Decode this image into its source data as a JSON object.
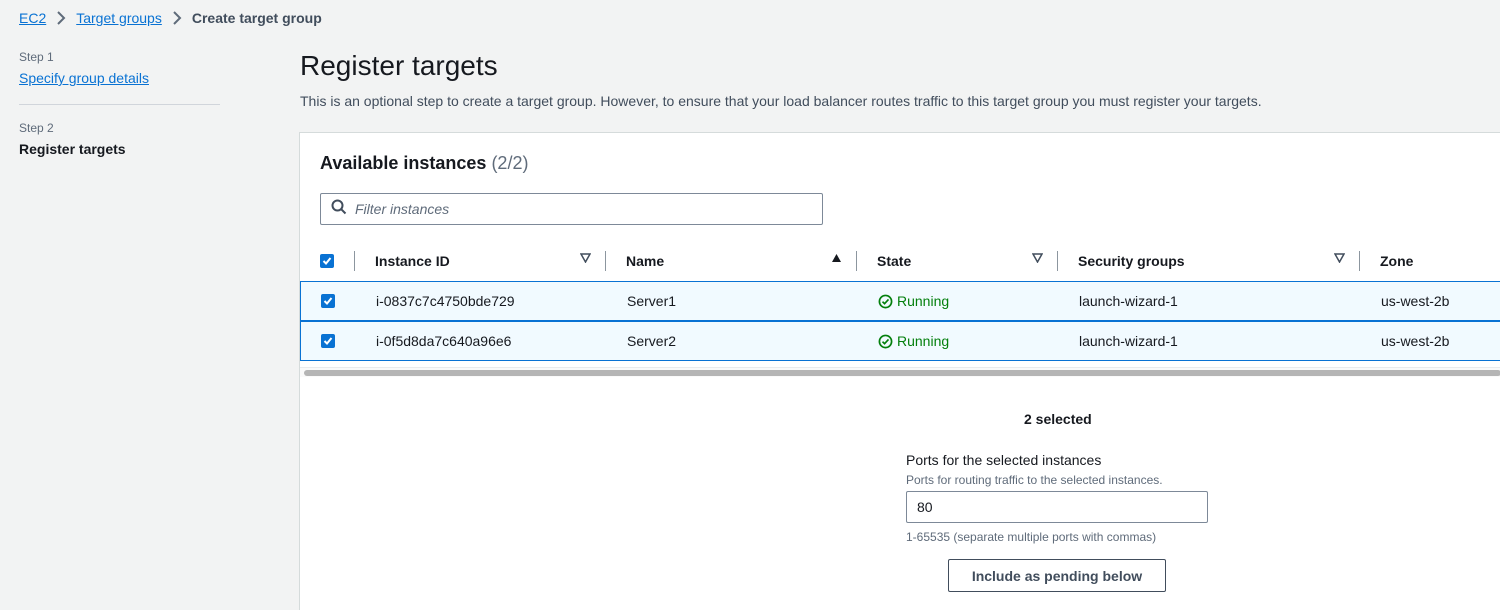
{
  "breadcrumb": {
    "items": [
      "EC2",
      "Target groups"
    ],
    "current": "Create target group"
  },
  "steps": [
    {
      "label": "Step 1",
      "title": "Specify group details"
    },
    {
      "label": "Step 2",
      "title": "Register targets"
    }
  ],
  "page": {
    "title": "Register targets",
    "description": "This is an optional step to create a target group. However, to ensure that your load balancer routes traffic to this target group you must register your targets."
  },
  "instances": {
    "title": "Available instances",
    "count": "(2/2)",
    "filter_placeholder": "Filter instances",
    "columns": [
      "Instance ID",
      "Name",
      "State",
      "Security groups",
      "Zone"
    ],
    "rows": [
      {
        "id": "i-0837c7c4750bde729",
        "name": "Server1",
        "state": "Running",
        "security_group": "launch-wizard-1",
        "zone": "us-west-2b",
        "checked": true
      },
      {
        "id": "i-0f5d8da7c640a96e6",
        "name": "Server2",
        "state": "Running",
        "security_group": "launch-wizard-1",
        "zone": "us-west-2b",
        "checked": true
      }
    ]
  },
  "selection": {
    "count_label": "2 selected",
    "ports_label": "Ports for the selected instances",
    "ports_description": "Ports for routing traffic to the selected instances.",
    "ports_value": "80",
    "ports_hint": "1-65535 (separate multiple ports with commas)",
    "include_button": "Include as pending below"
  },
  "colors": {
    "link": "#0972d3",
    "running": "#037f0c",
    "selected_row_bg": "#f1faff"
  }
}
